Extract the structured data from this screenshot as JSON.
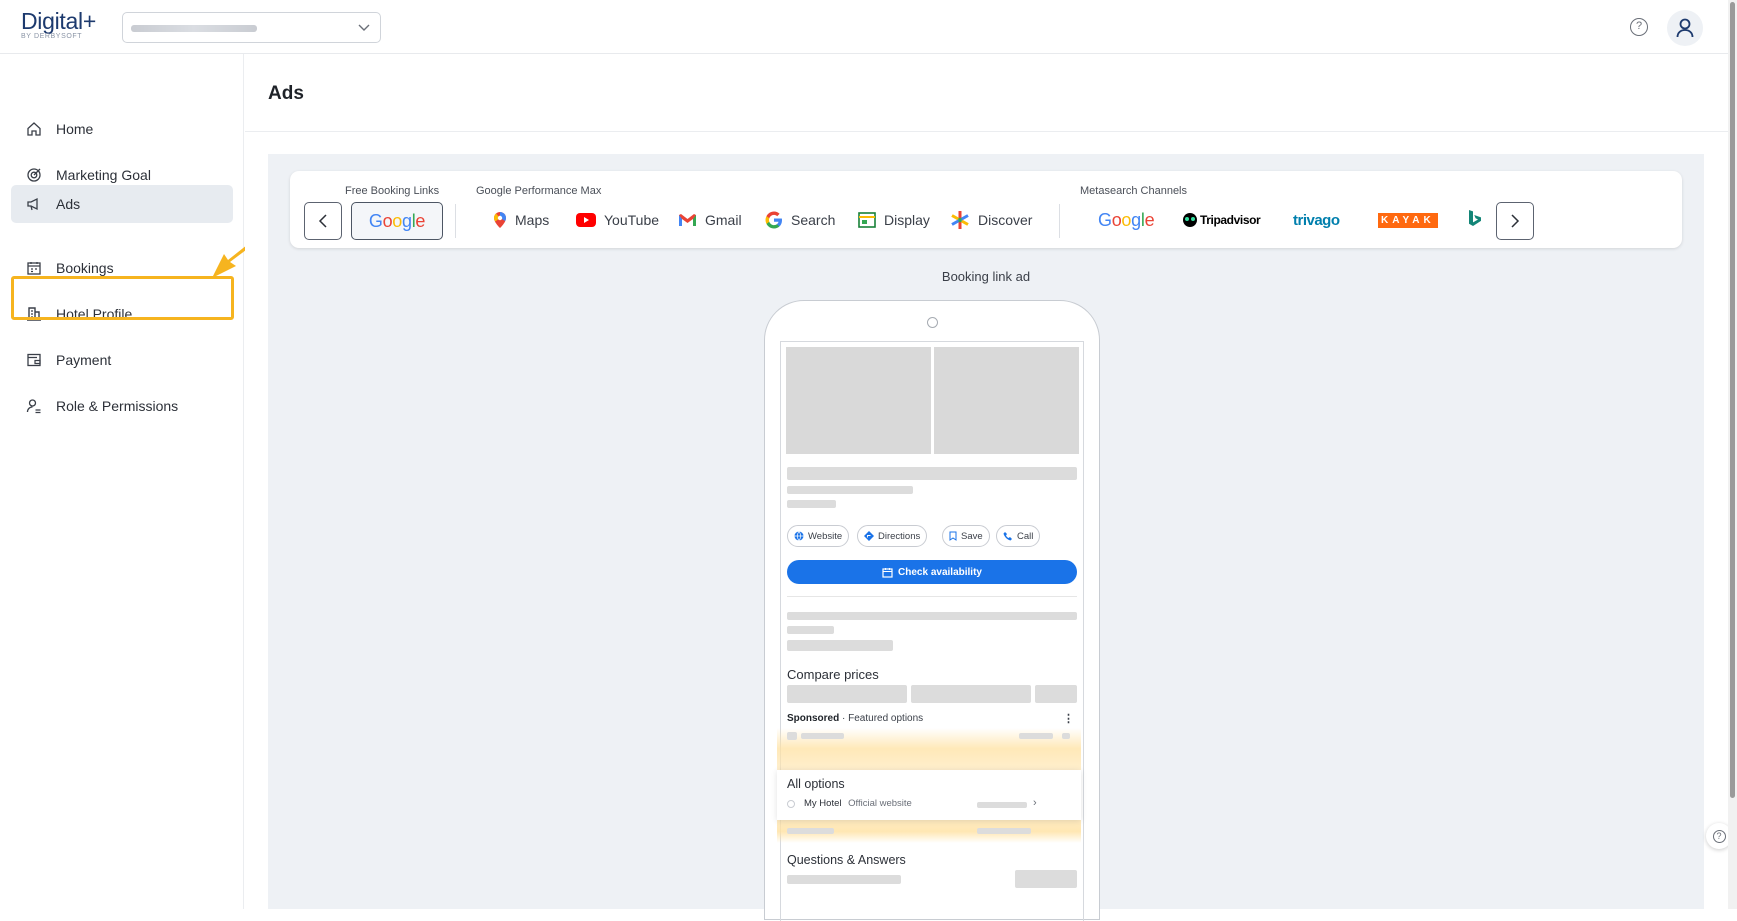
{
  "app": {
    "brand": "Digital+",
    "brand_sub": "BY DERBYSOFT"
  },
  "topbar": {
    "hotel_selector_value": "",
    "help_icon": "help-circle-icon",
    "avatar_icon": "user-icon"
  },
  "sidebar": {
    "items": [
      {
        "label": "Home",
        "icon": "home-icon"
      },
      {
        "label": "Marketing Goal",
        "icon": "target-icon"
      },
      {
        "label": "Ads",
        "icon": "megaphone-icon"
      },
      {
        "label": "Bookings",
        "icon": "calendar-icon"
      },
      {
        "label": "Hotel Profile",
        "icon": "building-icon"
      },
      {
        "label": "Payment",
        "icon": "wallet-icon"
      },
      {
        "label": "Role & Permissions",
        "icon": "user-settings-icon"
      }
    ],
    "active_index": 2,
    "highlight_index": 4
  },
  "page": {
    "title": "Ads"
  },
  "channels": {
    "group_labels": {
      "free": "Free Booking Links",
      "pmax": "Google Performance Max",
      "meta": "Metasearch Channels"
    },
    "free_selected": "Google",
    "pmax": [
      "Maps",
      "YouTube",
      "Gmail",
      "Search",
      "Display",
      "Discover"
    ],
    "meta": [
      "Google",
      "Tripadvisor",
      "trivago",
      "KAYAK"
    ]
  },
  "preview": {
    "title": "Booking link ad",
    "chips": [
      "Website",
      "Directions",
      "Save",
      "Call"
    ],
    "check_button": "Check availability",
    "compare_prices": "Compare prices",
    "sponsored": "Sponsored",
    "featured": " · Featured options",
    "all_options": "All options",
    "my_hotel": "My Hotel",
    "official": "Official website",
    "qa": "Questions & Answers"
  },
  "colors": {
    "accent": "#1a73e8",
    "highlight": "#f6b41f",
    "active_nav": "#e7ebf0"
  }
}
